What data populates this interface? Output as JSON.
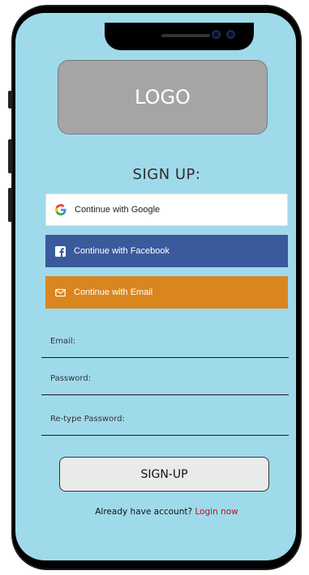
{
  "logo": {
    "text": "LOGO"
  },
  "signup": {
    "title": "SIGN UP:"
  },
  "auth_buttons": {
    "google": {
      "label": "Continue with Google",
      "icon": "google-g-icon",
      "bg": "#ffffff"
    },
    "facebook": {
      "label": "Continue with Facebook",
      "icon": "facebook-icon",
      "bg": "#3b5a9c"
    },
    "email": {
      "label": "Continue with Email",
      "icon": "mail-icon",
      "bg": "#d9861f"
    }
  },
  "fields": {
    "email": {
      "label": "Email:",
      "value": ""
    },
    "password": {
      "label": "Password:",
      "value": ""
    },
    "retype_password": {
      "label": "Re-type Password:",
      "value": ""
    }
  },
  "submit": {
    "label": "SIGN-UP"
  },
  "footer": {
    "prompt": "Already have account?",
    "link": "Login now",
    "link_color": "#c0101a"
  },
  "colors": {
    "screen_bg": "#9fdaea",
    "logo_bg": "#a5a5a5"
  }
}
